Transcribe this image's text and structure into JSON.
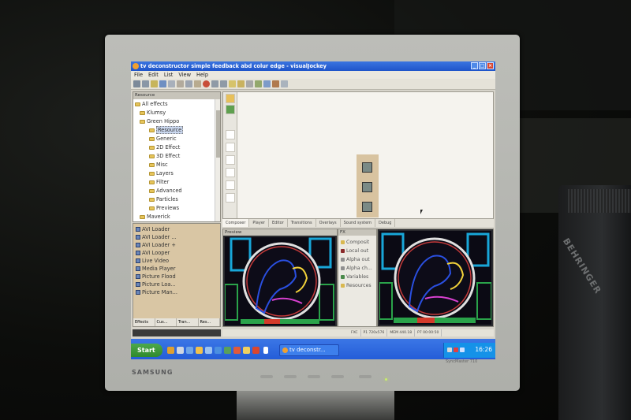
{
  "window": {
    "title": "tv deconstructor simple feedback abd colur edge - visualJockey"
  },
  "menu": [
    "File",
    "Edit",
    "List",
    "View",
    "Help"
  ],
  "resource_panel": {
    "header": "Resource",
    "items": [
      {
        "label": "All effects"
      },
      {
        "label": "Klumsy"
      },
      {
        "label": "Green Hippo"
      },
      {
        "label": "Resource"
      },
      {
        "label": "Generic"
      },
      {
        "label": "2D Effect"
      },
      {
        "label": "3D Effect"
      },
      {
        "label": "Misc"
      },
      {
        "label": "Layers"
      },
      {
        "label": "Filter"
      },
      {
        "label": "Advanced"
      },
      {
        "label": "Particles"
      },
      {
        "label": "Previews"
      },
      {
        "label": "Maverick"
      }
    ]
  },
  "effects_list": {
    "items": [
      {
        "label": "AVI Loader"
      },
      {
        "label": "AVI Loader ..."
      },
      {
        "label": "AVI Loader +"
      },
      {
        "label": "AVI Looper"
      },
      {
        "label": "Live Video"
      },
      {
        "label": "Media Player"
      },
      {
        "label": "Picture Flood"
      },
      {
        "label": "Picture Loa..."
      },
      {
        "label": "Picture Man..."
      }
    ],
    "tabs": [
      "Effects",
      "Cus...",
      "Tran...",
      "Res..."
    ]
  },
  "composer": {
    "tabs": [
      "Composer",
      "Player",
      "Editor",
      "Transitions",
      "Overlays",
      "Sound system",
      "Debug"
    ]
  },
  "preview_panel": {
    "header": "Preview"
  },
  "fx_panel": {
    "header": "FX",
    "items": [
      {
        "label": "Composit"
      },
      {
        "label": "Local out"
      },
      {
        "label": "Alpha out"
      },
      {
        "label": "Alpha ch..."
      },
      {
        "label": "Variables"
      },
      {
        "label": "Resources"
      }
    ]
  },
  "statusbar": {
    "fx": "FXC",
    "resolution": "P1 720x576",
    "memory": "MEM 440.18",
    "time": "P7 00:00:50"
  },
  "taskbar": {
    "start_label": "Start",
    "task_label": "tv deconstr...",
    "clock": "16:26"
  },
  "hardware": {
    "monitor_brand": "SAMSUNG",
    "monitor_model": "SyncMaster 710",
    "device_brand": "BEHRINGER"
  },
  "colors": {
    "titlebar": "#245dd8",
    "taskbar": "#245dd8",
    "start_button": "#2f8a2d",
    "effects_panel": "#d9c6a4"
  }
}
